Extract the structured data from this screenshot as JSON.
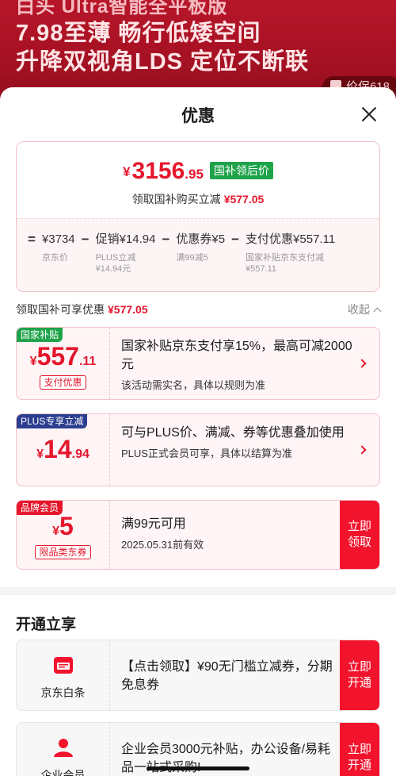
{
  "banner": {
    "top_partial": "白头 Ultra智能全平板版",
    "line1": "7.98至薄 畅行低矮空间",
    "line2": "升降双视角LDS 定位不断联",
    "pill": "价保618"
  },
  "sheet": {
    "title": "优惠"
  },
  "summary": {
    "currency": "¥",
    "price_int": "3156",
    "price_dec": ".95",
    "badge": "国补领后价",
    "claim_text": "领取国补购买立减",
    "claim_amount": "¥577.05",
    "formula": [
      {
        "op": "=",
        "main": "¥3734",
        "sub": "京东价"
      },
      {
        "op": "−",
        "main": "促销¥14.94",
        "sub": "PLUS立减\n¥14.94元"
      },
      {
        "op": "−",
        "main": "优惠券¥5",
        "sub": "满99减5"
      },
      {
        "op": "−",
        "main": "支付优惠¥557.11",
        "sub": "国家补贴京东支付减\n¥557.11"
      }
    ]
  },
  "section": {
    "label": "领取国补可享优惠",
    "amount": "¥577.05",
    "collapse": "收起"
  },
  "coupons": [
    {
      "tag": "国家补贴",
      "sym": "¥",
      "int": "557",
      "dec": ".11",
      "pill": "支付优惠",
      "main": "国家补贴京东支付享15%，最高可减2000元",
      "sub": "该活动需实名，具体以规则为准"
    },
    {
      "tag": "PLUS专享立减",
      "sym": "¥",
      "int": "14",
      "dec": ".94",
      "main": "可与PLUS价、满减、券等优惠叠加使用",
      "sub": "PLUS正式会员可享，具体以结算为准"
    },
    {
      "tag": "品牌会员",
      "sym": "¥",
      "int": "5",
      "pill": "限品类东券",
      "main": "满99元可用",
      "sub": "2025.05.31前有效",
      "button": "立即领取"
    }
  ],
  "open": {
    "title": "开通立享",
    "items": [
      {
        "icon": "baitiao-icon",
        "name": "京东白条",
        "desc": "【点击领取】¥90无门槛立减券，分期免息券",
        "button": "立即开通"
      },
      {
        "icon": "user-icon",
        "name": "企业会员",
        "desc": "企业会员3000元补贴，办公设备/易耗品一站式采购!",
        "button": "立即开通"
      }
    ]
  },
  "colors": {
    "accent": "#e5162c",
    "green": "#1fa34a",
    "navy": "#2c3e8f"
  }
}
